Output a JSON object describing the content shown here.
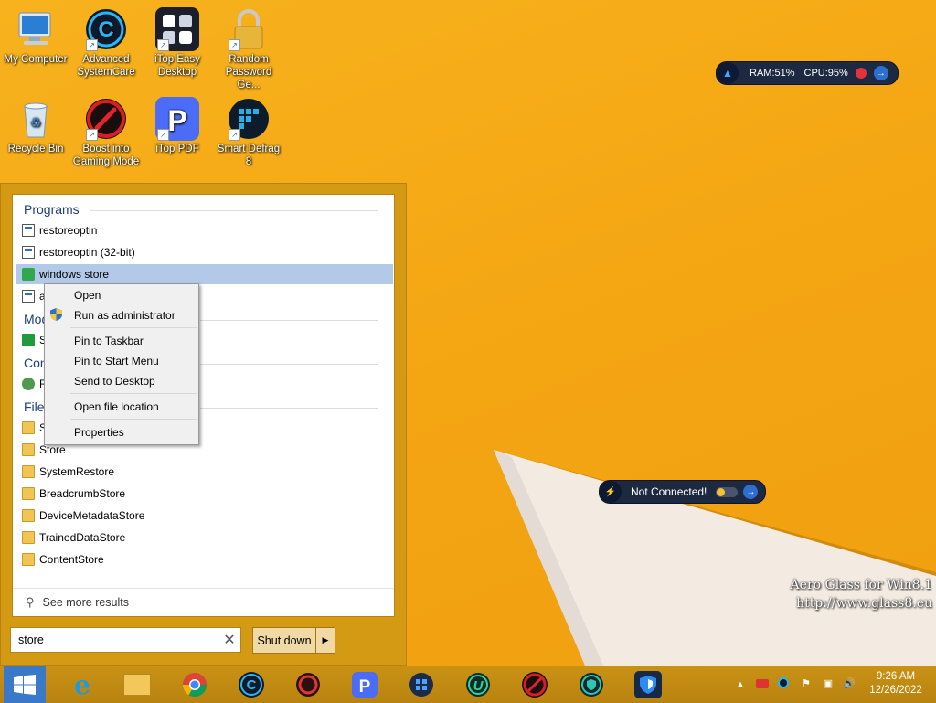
{
  "desktop": {
    "icons": [
      {
        "label": "My Computer"
      },
      {
        "label": "Advanced SystemCare"
      },
      {
        "label": "iTop Easy Desktop"
      },
      {
        "label": "Random Password Ge..."
      },
      {
        "label": "Recycle Bin"
      },
      {
        "label": "Boost into Gaming Mode"
      },
      {
        "label": "iTop PDF"
      },
      {
        "label": "Smart Defrag 8"
      }
    ],
    "monitor_gadget": {
      "ram": "RAM:51%",
      "cpu": "CPU:95%"
    },
    "network_gadget": {
      "status": "Not Connected!"
    },
    "watermark": {
      "line1": "Aero Glass for Win8.1",
      "line2": "http://www.glass8.eu"
    }
  },
  "start_search": {
    "groups": {
      "programs": "Programs",
      "modern": "Mod",
      "control": "Con",
      "files": "Files"
    },
    "programs": [
      {
        "label": "restoreoptin"
      },
      {
        "label": "restoreoptin (32-bit)"
      },
      {
        "label": "windows store"
      },
      {
        "label": "a"
      }
    ],
    "modern_items": [
      {
        "label": "S"
      }
    ],
    "control_items": [
      {
        "label": "R"
      }
    ],
    "files": [
      {
        "label": "S"
      },
      {
        "label": "Store"
      },
      {
        "label": "SystemRestore"
      },
      {
        "label": "BreadcrumbStore"
      },
      {
        "label": "DeviceMetadataStore"
      },
      {
        "label": "TrainedDataStore"
      },
      {
        "label": "ContentStore"
      }
    ],
    "see_more": "See more results",
    "query": "store",
    "shutdown_label": "Shut down"
  },
  "context_menu": {
    "items": [
      {
        "label": "Open"
      },
      {
        "label": "Run as administrator"
      },
      {
        "label": "Pin to Taskbar"
      },
      {
        "label": "Pin to Start Menu"
      },
      {
        "label": "Send to Desktop"
      },
      {
        "label": "Open file location"
      },
      {
        "label": "Properties"
      }
    ]
  },
  "taskbar": {
    "clock_time": "9:26 AM",
    "clock_date": "12/26/2022",
    "pinned": [
      "internet-explorer-icon",
      "file-explorer-icon",
      "chrome-icon",
      "advanced-systemcare-icon",
      "iobit-driver-booster-icon",
      "itop-pdf-icon",
      "windows-store-icon",
      "iobit-uninstaller-icon",
      "game-booster-icon",
      "iobit-malware-fighter-icon",
      "itop-vpn-icon"
    ]
  },
  "colors": {
    "desktop": "#f4a512",
    "selection": "#b3c9e8",
    "group_header": "#1e3d7a"
  }
}
